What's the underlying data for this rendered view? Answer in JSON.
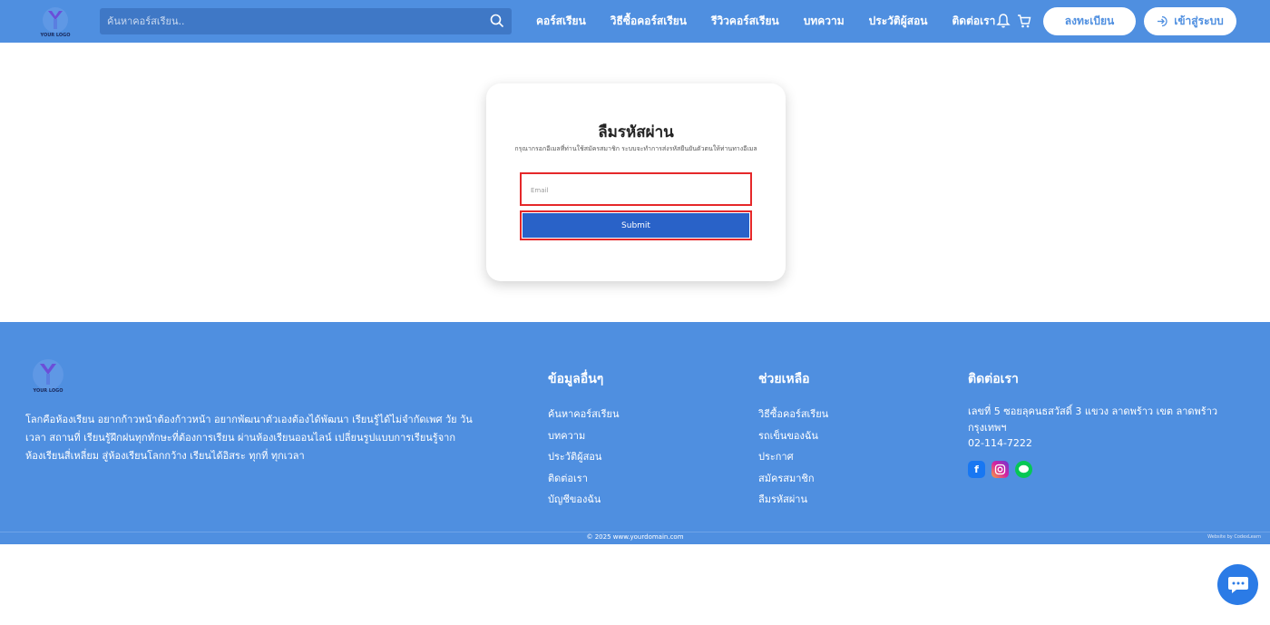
{
  "header": {
    "logo_text": "YOUR LOGO",
    "search": {
      "placeholder": "ค้นหาคอร์สเรียน.."
    },
    "nav": [
      "คอร์สเรียน",
      "วิธีซื้อคอร์สเรียน",
      "รีวิวคอร์สเรียน",
      "บทความ",
      "ประวัติผู้สอน",
      "ติดต่อเรา"
    ],
    "register_label": "ลงทะเบียน",
    "login_label": "เข้าสู่ระบบ"
  },
  "form": {
    "title": "ลืมรหัสผ่าน",
    "description": "กรุณากรอกอีเมลที่ท่านใช้สมัครสมาชิก ระบบจะทำการส่งรหัสยืนยันตัวตนให้ท่านทางอีเมล",
    "email_placeholder": "Email",
    "submit_label": "Submit"
  },
  "footer": {
    "logo_text": "YOUR LOGO",
    "about": "โลกคือห้องเรียน อยากก้าวหน้าต้องก้าวหน้า อยากพัฒนาตัวเองต้องได้พัฒนา เรียนรู้ได้ไม่จำกัดเพศ วัย วัน เวลา สถานที่ เรียนรู้ฝึกฝนทุกทักษะที่ต้องการเรียน ผ่านห้องเรียนออนไลน์ เปลี่ยนรูปแบบการเรียนรู้จากห้องเรียนสี่เหลี่ยม สู่ห้องเรียนโลกกว้าง เรียนได้อิสระ ทุกที่ ทุกเวลา",
    "col1": {
      "title": "ข้อมูลอื่นๆ",
      "links": [
        "ค้นหาคอร์สเรียน",
        "บทความ",
        "ประวัติผู้สอน",
        "ติดต่อเรา",
        "บัญชีของฉัน"
      ]
    },
    "col2": {
      "title": "ช่วยเหลือ",
      "links": [
        "วิธีซื้อคอร์สเรียน",
        "รถเข็นของฉัน",
        "ประกาศ",
        "สมัครสมาชิก",
        "ลืมรหัสผ่าน"
      ]
    },
    "col3": {
      "title": "ติดต่อเรา",
      "address": "เลขที่ 5 ซอยลุคนธสวัสดิ์ 3 แขวง ลาดพร้าว เขต ลาดพร้าว กรุงเทพฯ",
      "phone": "02-114-7222"
    },
    "copyright": "© 2025 www.yourdomain.com",
    "credit": "Website by CodexLearn"
  },
  "colors": {
    "primary": "#4f8fe0",
    "submit": "#2962c8",
    "highlight": "#e5282a"
  },
  "icons": [
    "search-icon",
    "bell-icon",
    "cart-icon",
    "login-icon",
    "facebook-icon",
    "instagram-icon",
    "line-icon",
    "chat-icon"
  ]
}
